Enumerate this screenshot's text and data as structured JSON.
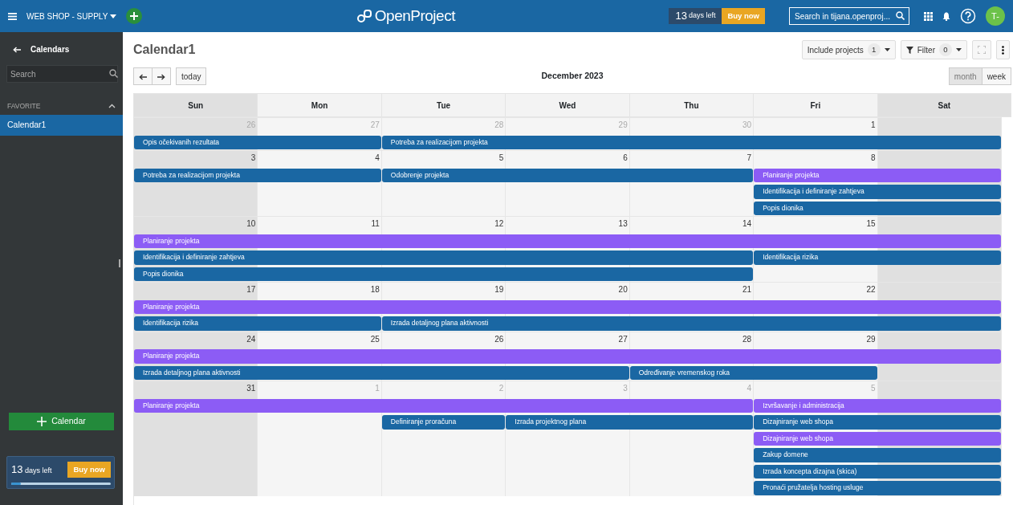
{
  "topbar": {
    "project": "WEB SHOP - SUPPLY",
    "logo": "OpenProject",
    "trial": {
      "days": "13",
      "label": "days left",
      "button": "Buy now"
    },
    "search": {
      "placeholder": "Search in tijana.openproj..."
    },
    "avatar": "T-"
  },
  "sidebar": {
    "title": "Calendars",
    "search": {
      "placeholder": "Search"
    },
    "section": {
      "label": "FAVORITE",
      "expanded": true
    },
    "items": [
      {
        "label": "Calendar1",
        "selected": true
      }
    ],
    "add_button": "Calendar",
    "trial": {
      "days": "13",
      "label": "days left",
      "button": "Buy now",
      "level": 0.1
    }
  },
  "main": {
    "title": "Calendar1",
    "include_projects": {
      "label": "Include projects",
      "count": "1"
    },
    "filter": {
      "label": "Filter",
      "count": "0"
    },
    "today_button": "today",
    "period": "December 2023",
    "views": [
      {
        "label": "month",
        "selected": true
      },
      {
        "label": "week",
        "selected": false
      }
    ],
    "weekdays": [
      "Sun",
      "Mon",
      "Tue",
      "Wed",
      "Thu",
      "Fri",
      "Sat"
    ],
    "weeks": [
      {
        "days": [
          {
            "number": "26",
            "other_month": true
          },
          {
            "number": "27",
            "other_month": true
          },
          {
            "number": "28",
            "other_month": true
          },
          {
            "number": "29",
            "other_month": true
          },
          {
            "number": "30",
            "other_month": true
          },
          {
            "number": "1",
            "other_month": false
          }
        ],
        "lanes": [
          [
            {
              "kind": "start",
              "title": "Opis očekivanih rezultata",
              "color": "#1a67a3"
            },
            {
              "kind": "cont"
            },
            {
              "kind": "start",
              "title": "Potreba za realizacijom projekta",
              "color": "#1a67a3"
            },
            {
              "kind": "cont"
            },
            {
              "kind": "cont"
            },
            {
              "kind": "cont"
            },
            {
              "kind": "cont"
            }
          ]
        ]
      },
      {
        "days": [
          {
            "number": "3",
            "other_month": false
          },
          {
            "number": "4",
            "other_month": false
          },
          {
            "number": "5",
            "other_month": false
          },
          {
            "number": "6",
            "other_month": false
          },
          {
            "number": "7",
            "other_month": false
          },
          {
            "number": "8",
            "other_month": false
          }
        ],
        "lanes": [
          [
            {
              "kind": "start",
              "title": "Potreba za realizacijom projekta",
              "color": "#1a67a3"
            },
            {
              "kind": "cont"
            },
            {
              "kind": "start",
              "title": "Odobrenje projekta",
              "color": "#1a67a3"
            },
            {
              "kind": "cont"
            },
            {
              "kind": "cont"
            },
            {
              "kind": "start",
              "title": "Planiranje projekta",
              "color": "#8c5cf5"
            },
            {
              "kind": "cont"
            }
          ],
          [
            {
              "kind": "empty"
            },
            {
              "kind": "empty"
            },
            {
              "kind": "empty"
            },
            {
              "kind": "empty"
            },
            {
              "kind": "empty"
            },
            {
              "kind": "start",
              "title": "Identifikacija i definiranje zahtjeva",
              "color": "#1a67a3"
            },
            {
              "kind": "cont"
            }
          ],
          [
            {
              "kind": "empty"
            },
            {
              "kind": "empty"
            },
            {
              "kind": "empty"
            },
            {
              "kind": "empty"
            },
            {
              "kind": "empty"
            },
            {
              "kind": "start",
              "title": "Popis dionika",
              "color": "#1a67a3"
            },
            {
              "kind": "cont"
            }
          ]
        ]
      },
      {
        "days": [
          {
            "number": "10",
            "other_month": false
          },
          {
            "number": "11",
            "other_month": false
          },
          {
            "number": "12",
            "other_month": false
          },
          {
            "number": "13",
            "other_month": false
          },
          {
            "number": "14",
            "other_month": false
          },
          {
            "number": "15",
            "other_month": false
          }
        ],
        "lanes": [
          [
            {
              "kind": "start",
              "title": "Planiranje projekta",
              "color": "#8c5cf5"
            },
            {
              "kind": "cont"
            },
            {
              "kind": "cont"
            },
            {
              "kind": "cont"
            },
            {
              "kind": "cont"
            },
            {
              "kind": "cont"
            },
            {
              "kind": "cont"
            }
          ],
          [
            {
              "kind": "start",
              "title": "Identifikacija i definiranje zahtjeva",
              "color": "#1a67a3"
            },
            {
              "kind": "cont"
            },
            {
              "kind": "cont"
            },
            {
              "kind": "cont"
            },
            {
              "kind": "cont"
            },
            {
              "kind": "start",
              "title": "Identifikacija rizika",
              "color": "#1a67a3"
            },
            {
              "kind": "cont"
            }
          ],
          [
            {
              "kind": "start",
              "title": "Popis dionika",
              "color": "#1a67a3"
            },
            {
              "kind": "cont"
            },
            {
              "kind": "cont"
            },
            {
              "kind": "cont"
            },
            {
              "kind": "cont"
            },
            {
              "kind": "empty"
            },
            {
              "kind": "empty"
            }
          ]
        ]
      },
      {
        "days": [
          {
            "number": "17",
            "other_month": false
          },
          {
            "number": "18",
            "other_month": false
          },
          {
            "number": "19",
            "other_month": false
          },
          {
            "number": "20",
            "other_month": false
          },
          {
            "number": "21",
            "other_month": false
          },
          {
            "number": "22",
            "other_month": false
          }
        ],
        "lanes": [
          [
            {
              "kind": "start",
              "title": "Planiranje projekta",
              "color": "#8c5cf5"
            },
            {
              "kind": "cont"
            },
            {
              "kind": "cont"
            },
            {
              "kind": "cont"
            },
            {
              "kind": "cont"
            },
            {
              "kind": "cont"
            },
            {
              "kind": "cont"
            }
          ],
          [
            {
              "kind": "start",
              "title": "Identifikacija rizika",
              "color": "#1a67a3"
            },
            {
              "kind": "cont"
            },
            {
              "kind": "start",
              "title": "Izrada detaljnog plana aktivnosti",
              "color": "#1a67a3"
            },
            {
              "kind": "cont"
            },
            {
              "kind": "cont"
            },
            {
              "kind": "cont"
            },
            {
              "kind": "cont"
            }
          ]
        ]
      },
      {
        "days": [
          {
            "number": "24",
            "other_month": false
          },
          {
            "number": "25",
            "other_month": false
          },
          {
            "number": "26",
            "other_month": false
          },
          {
            "number": "27",
            "other_month": false
          },
          {
            "number": "28",
            "other_month": false
          },
          {
            "number": "29",
            "other_month": false
          }
        ],
        "lanes": [
          [
            {
              "kind": "start",
              "title": "Planiranje projekta",
              "color": "#8c5cf5"
            },
            {
              "kind": "cont"
            },
            {
              "kind": "cont"
            },
            {
              "kind": "cont"
            },
            {
              "kind": "cont"
            },
            {
              "kind": "cont"
            },
            {
              "kind": "cont"
            }
          ],
          [
            {
              "kind": "start",
              "title": "Izrada detaljnog plana aktivnosti",
              "color": "#1a67a3"
            },
            {
              "kind": "cont"
            },
            {
              "kind": "cont"
            },
            {
              "kind": "cont"
            },
            {
              "kind": "start",
              "title": "Određivanje vremenskog roka",
              "color": "#1a67a3"
            },
            {
              "kind": "cont"
            },
            {
              "kind": "empty"
            }
          ]
        ]
      },
      {
        "days": [
          {
            "number": "31",
            "other_month": false
          },
          {
            "number": "1",
            "other_month": true
          },
          {
            "number": "2",
            "other_month": true
          },
          {
            "number": "3",
            "other_month": true
          },
          {
            "number": "4",
            "other_month": true
          },
          {
            "number": "5",
            "other_month": true
          }
        ],
        "lanes": [
          [
            {
              "kind": "start",
              "title": "Planiranje projekta",
              "color": "#8c5cf5"
            },
            {
              "kind": "cont"
            },
            {
              "kind": "cont"
            },
            {
              "kind": "cont"
            },
            {
              "kind": "cont"
            },
            {
              "kind": "start",
              "title": "Izvršavanje i administracija",
              "color": "#8c5cf5"
            },
            {
              "kind": "cont"
            }
          ],
          [
            {
              "kind": "empty"
            },
            {
              "kind": "empty"
            },
            {
              "kind": "start",
              "title": "Definiranje proračuna",
              "color": "#1a67a3"
            },
            {
              "kind": "start",
              "title": "Izrada projektnog plana",
              "color": "#1a67a3"
            },
            {
              "kind": "cont"
            },
            {
              "kind": "start",
              "title": "Dizajniranje web shopa",
              "color": "#1a67a3"
            },
            {
              "kind": "cont"
            }
          ],
          [
            {
              "kind": "empty"
            },
            {
              "kind": "empty"
            },
            {
              "kind": "empty"
            },
            {
              "kind": "empty"
            },
            {
              "kind": "empty"
            },
            {
              "kind": "start",
              "title": "Dizajniranje web shopa",
              "color": "#8c5cf5"
            },
            {
              "kind": "cont"
            }
          ],
          [
            {
              "kind": "empty"
            },
            {
              "kind": "empty"
            },
            {
              "kind": "empty"
            },
            {
              "kind": "empty"
            },
            {
              "kind": "empty"
            },
            {
              "kind": "start",
              "title": "Zakup domene",
              "color": "#1a67a3"
            },
            {
              "kind": "cont"
            }
          ],
          [
            {
              "kind": "empty"
            },
            {
              "kind": "empty"
            },
            {
              "kind": "empty"
            },
            {
              "kind": "empty"
            },
            {
              "kind": "empty"
            },
            {
              "kind": "start",
              "title": "Izrada koncepta dizajna (skica)",
              "color": "#1a67a3"
            },
            {
              "kind": "cont"
            }
          ],
          [
            {
              "kind": "empty"
            },
            {
              "kind": "empty"
            },
            {
              "kind": "empty"
            },
            {
              "kind": "empty"
            },
            {
              "kind": "empty"
            },
            {
              "kind": "start",
              "title": "Pronaći pružatelja hosting usluge",
              "color": "#1a67a3"
            },
            {
              "kind": "cont"
            }
          ]
        ]
      }
    ]
  }
}
